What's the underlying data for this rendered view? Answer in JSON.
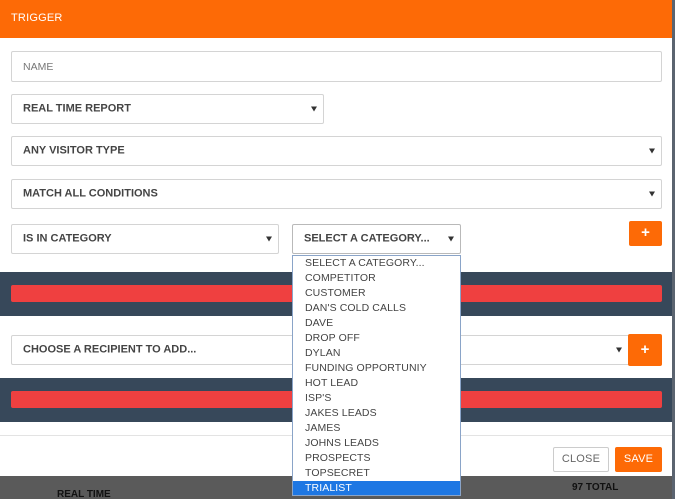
{
  "modal": {
    "title": "TRIGGER",
    "name_placeholder": "NAME",
    "report_select": "REAL TIME REPORT",
    "visitor_select": "ANY VISITOR TYPE",
    "match_select": "MATCH ALL CONDITIONS",
    "condition_select": "IS IN CATEGORY",
    "category_select": "SELECT A CATEGORY...",
    "add_condition_label": "+",
    "recipient_select": "CHOOSE A RECIPIENT TO ADD...",
    "add_recipient_label": "+",
    "close_label": "CLOSE",
    "save_label": "SAVE"
  },
  "category_options": [
    "SELECT A CATEGORY...",
    "COMPETITOR",
    "CUSTOMER",
    "DAN'S COLD CALLS",
    "DAVE",
    "DROP OFF",
    "DYLAN",
    "FUNDING OPPORTUNIY",
    "HOT LEAD",
    "ISP'S",
    "JAKES LEADS",
    "JAMES",
    "JOHNS LEADS",
    "PROSPECTS",
    "TOPSECRET",
    "TRIALIST"
  ],
  "selected_option": "TRIALIST",
  "backdrop": {
    "left_text": "REAL TIME",
    "right_text": "97 TOTAL"
  },
  "colors": {
    "accent": "#fd6a06",
    "dark_band": "#37485a",
    "alert_bar": "#ef4040",
    "selection": "#1e77e3"
  }
}
